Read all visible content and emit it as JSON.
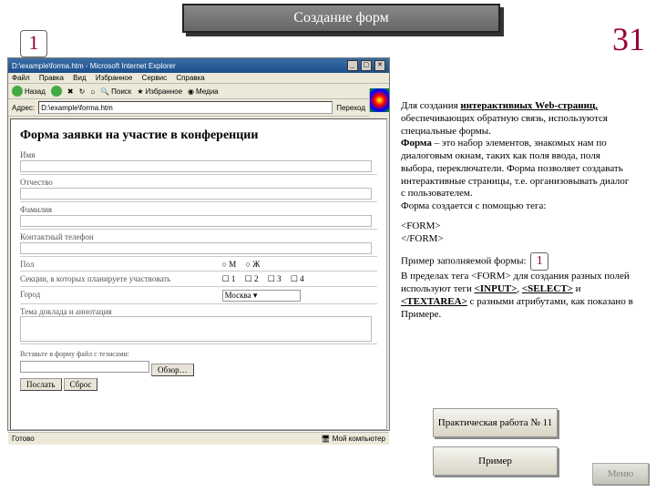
{
  "slide": {
    "title": "Создание форм",
    "page_number": "31",
    "badge_main": "1",
    "inline_badge": "1"
  },
  "browser": {
    "window_title": "D:\\example\\forma.htm - Microsoft Internet Explorer",
    "menu": {
      "file": "Файл",
      "edit": "Правка",
      "view": "Вид",
      "favorites": "Избранное",
      "tools": "Сервис",
      "help": "Справка"
    },
    "toolbar": {
      "back": "Назад",
      "search": "Поиск",
      "favorites": "Избранное",
      "media": "Медиа"
    },
    "address_label": "Адрес:",
    "address_value": "D:\\example\\forma.htm",
    "go": "Переход",
    "status_left": "Готово",
    "status_right": "Мой компьютер"
  },
  "form": {
    "heading": "Форма заявки на участие в конференции",
    "labels": {
      "name": "Имя",
      "patronymic": "Отчество",
      "surname": "Фамилия",
      "phone": "Контактный телефон",
      "gender": "Пол",
      "sections": "Секции, в которых планируете участвовать",
      "city": "Город",
      "topic": "Тема доклада и аннотация",
      "file_hint": "Вставьте в форму файл с тезисами:"
    },
    "gender_m": "М",
    "gender_f": "Ж",
    "sec": [
      "1",
      "2",
      "3",
      "4"
    ],
    "city_value": "Москва",
    "browse": "Обзор…",
    "submit": "Послать",
    "reset": "Сброс"
  },
  "text": {
    "p1a": "Для создания ",
    "p1b": "интерактивных Web-страниц,",
    "p1c": " обеспечивающих обратную связь, используются специальные формы.",
    "p2a": "Форма",
    "p2b": " – это набор элементов, знакомых нам по диалоговым окнам, таких как поля ввода, поля выбора, переключатели. Форма позволяет создавать интерактивные страницы, т.е. организовывать диалог с пользователем.",
    "p3": "Форма создается с помощью тега:",
    "code1": "<FORM>",
    "code2": "</FORM>",
    "p4": "Пример заполняемой формы:",
    "p5a": "В пределах тега <FORM> для создания разных полей используют теги ",
    "p5b": "<INPUT>",
    "p5c": ", ",
    "p5d": "<SELECT>",
    "p5e": " и ",
    "p5f": "<TEXTAREA>",
    "p5g": " с разными атрибутами, как показано в Примере."
  },
  "buttons": {
    "practice": "Практическая работа № 11",
    "example": "Пример",
    "menu": "Меню"
  }
}
